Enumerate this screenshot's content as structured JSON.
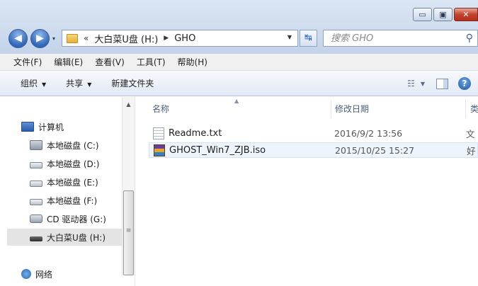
{
  "window": {
    "buttons": [
      {
        "name": "minimize",
        "glyph": "▭"
      },
      {
        "name": "maximize",
        "glyph": "▣"
      },
      {
        "name": "close",
        "glyph": "✕"
      }
    ]
  },
  "nav": {
    "back_glyph": "◀",
    "forward_glyph": "▶",
    "dropdown_glyph": "▾"
  },
  "address": {
    "overflow": "«",
    "crumbs": [
      "大白菜U盘 (H:)",
      "GHO"
    ],
    "separator": "▶",
    "dropdown_glyph": "▼",
    "refresh_glyph": "↹"
  },
  "search": {
    "placeholder": "搜索 GHO",
    "icon": "search-icon"
  },
  "menu": [
    "文件(F)",
    "编辑(E)",
    "查看(V)",
    "工具(T)",
    "帮助(H)"
  ],
  "toolbar": {
    "organize": "组织",
    "share": "共享",
    "new_folder": "新建文件夹",
    "dropdown_glyph": "▼",
    "view_glyph": "☷",
    "help_glyph": "?"
  },
  "navpane": {
    "items": [
      {
        "label": "计算机",
        "icon": "computer-icon"
      },
      {
        "label": "本地磁盘 (C:)",
        "icon": "system-drive-icon"
      },
      {
        "label": "本地磁盘 (D:)",
        "icon": "drive-icon"
      },
      {
        "label": "本地磁盘 (E:)",
        "icon": "drive-icon"
      },
      {
        "label": "本地磁盘 (F:)",
        "icon": "drive-icon"
      },
      {
        "label": "CD 驱动器 (G:)",
        "icon": "cd-drive-icon"
      },
      {
        "label": "大白菜U盘 (H:)",
        "icon": "usb-drive-icon"
      },
      {
        "label": "网络",
        "icon": "network-icon"
      }
    ],
    "selected": "大白菜U盘 (H:)",
    "scroll_up_glyph": "▲",
    "grip_glyph": "≡"
  },
  "filelist": {
    "columns": [
      "名称",
      "修改日期",
      "类"
    ],
    "sort_glyph": "▲",
    "files": [
      {
        "name": "Readme.txt",
        "date": "2016/9/2 13:56",
        "type": "文",
        "icon": "text-file-icon"
      },
      {
        "name": "GHOST_Win7_ZJB.iso",
        "date": "2015/10/25 15:27",
        "type": "好",
        "icon": "archive-file-icon"
      }
    ]
  }
}
